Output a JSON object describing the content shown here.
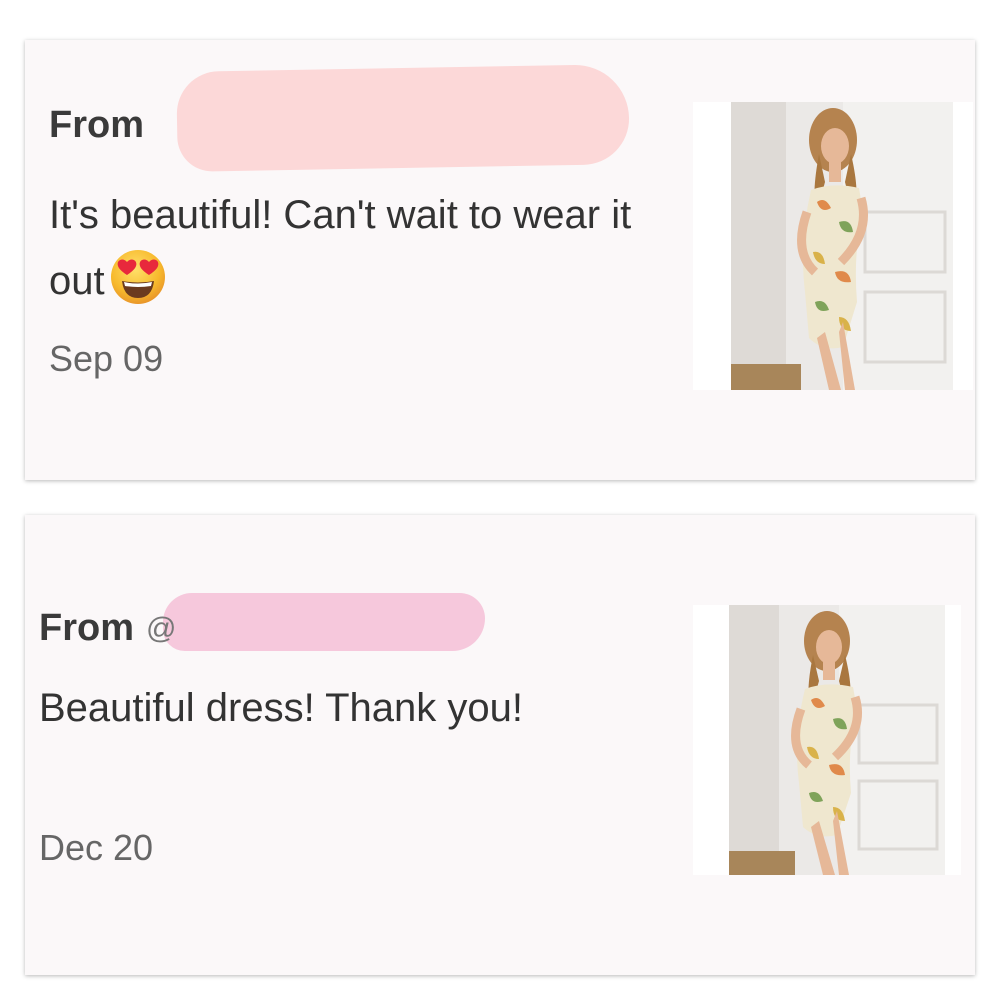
{
  "reviews": [
    {
      "from_label": "From",
      "message": "It's beautiful! Can't wait to wear it out",
      "emoji": "heart-eyes-emoji",
      "date": "Sep 09",
      "photo": "product-photo-dress"
    },
    {
      "from_label": "From",
      "handle_prefix": "@",
      "message": "Beautiful dress! Thank you!",
      "date": "Dec 20",
      "photo": "product-photo-dress"
    }
  ],
  "colors": {
    "card_background": "#fbf8f9",
    "text": "#333333",
    "date_text": "#666666",
    "redaction_pink_1": "#fcd8d8",
    "redaction_pink_2": "#f6c8dc",
    "emoji_yellow": "#f7b92c",
    "heart_red": "#e8283c"
  }
}
